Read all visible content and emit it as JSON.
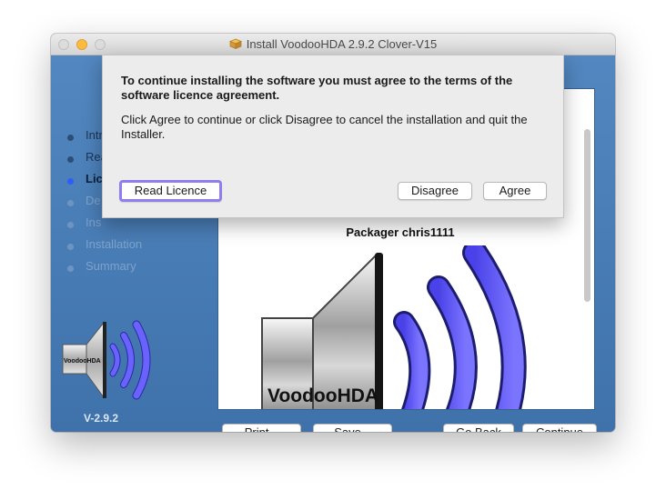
{
  "window": {
    "title": "Install VoodooHDA 2.9.2 Clover-V15",
    "icon": "package-icon"
  },
  "sidebar": {
    "steps": [
      {
        "label": "Intr",
        "state": "done"
      },
      {
        "label": "Rea",
        "state": "done"
      },
      {
        "label": "Lic",
        "state": "active"
      },
      {
        "label": "De",
        "state": "todo"
      },
      {
        "label": "Ins",
        "state": "todo"
      },
      {
        "label": "Installation",
        "state": "todo"
      },
      {
        "label": "Summary",
        "state": "todo"
      }
    ],
    "logo_text": "VoodooHDA",
    "version": "V-2.9.2"
  },
  "content": {
    "packager": "Packager chris1111",
    "logo_text": "VoodooHDA"
  },
  "buttons": {
    "print": "Print...",
    "save": "Save...",
    "go_back": "Go Back",
    "continue": "Continue"
  },
  "dialog": {
    "heading": "To continue installing the software you must agree to the terms of the software licence agreement.",
    "body": "Click Agree to continue or click Disagree to cancel the installation and quit the Installer.",
    "read_licence": "Read Licence",
    "disagree": "Disagree",
    "agree": "Agree"
  },
  "colors": {
    "sidebar_blue": "#4b7db2",
    "active_dot": "#2d5cff",
    "focus_ring": "#8f7ef0",
    "wave_purple": "#5a52f0"
  }
}
